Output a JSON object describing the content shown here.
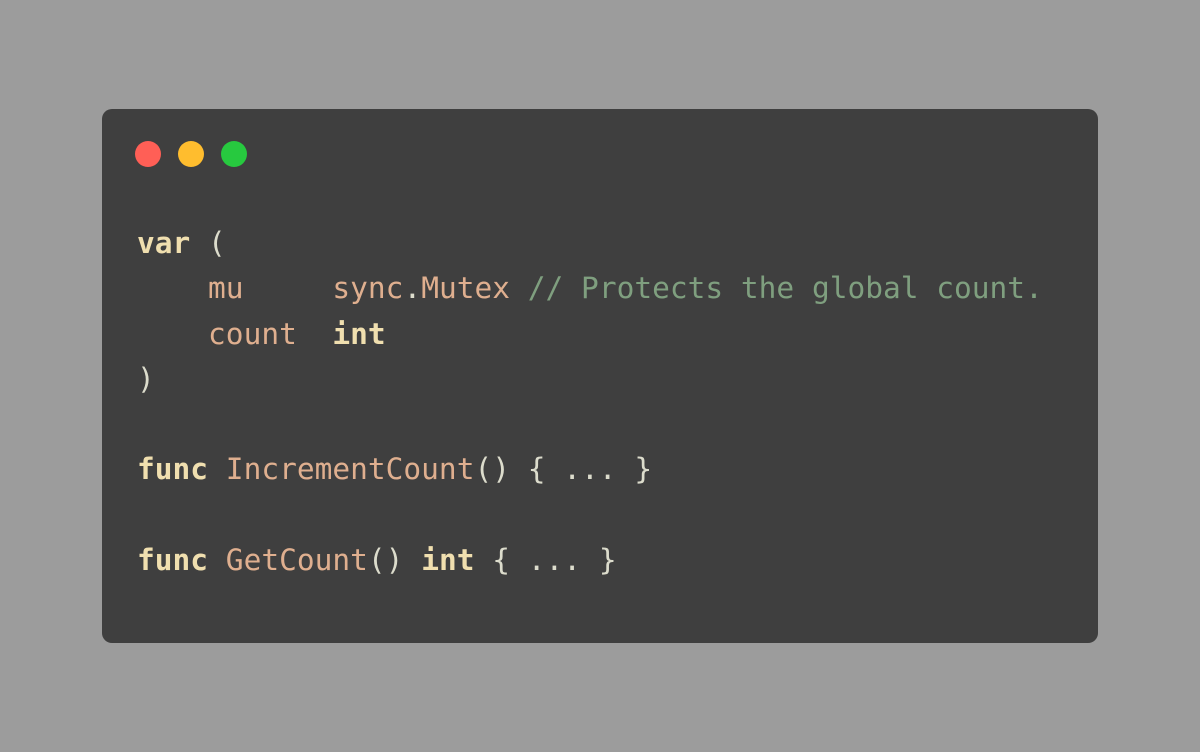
{
  "colors": {
    "background": "#9c9c9c",
    "window": "#3f3f3f",
    "close": "#ff5f56",
    "minimize": "#ffbd2e",
    "maximize": "#27c93f",
    "keyword": "#f0dfaf",
    "identifier": "#dfaf8f",
    "punctuation": "#dcdccc",
    "comment": "#7f9f7f"
  },
  "window_controls": {
    "close_icon": "red-circle",
    "minimize_icon": "yellow-circle",
    "maximize_icon": "green-circle"
  },
  "code": {
    "line1": {
      "kw": "var",
      "punct": " ("
    },
    "line2": {
      "indent": "    ",
      "name": "mu",
      "gap": "     ",
      "pkg": "sync",
      "dot": ".",
      "type": "Mutex",
      "comment": " // Protects the global count."
    },
    "line3": {
      "indent": "    ",
      "name": "count",
      "gap": "  ",
      "type": "int"
    },
    "line4": {
      "punct": ")"
    },
    "line5": {
      "kw": "func",
      "name": " IncrementCount",
      "punct": "() { ... }"
    },
    "line6": {
      "kw": "func",
      "name": " GetCount",
      "punct_a": "() ",
      "type": "int",
      "punct_b": " { ... }"
    }
  }
}
